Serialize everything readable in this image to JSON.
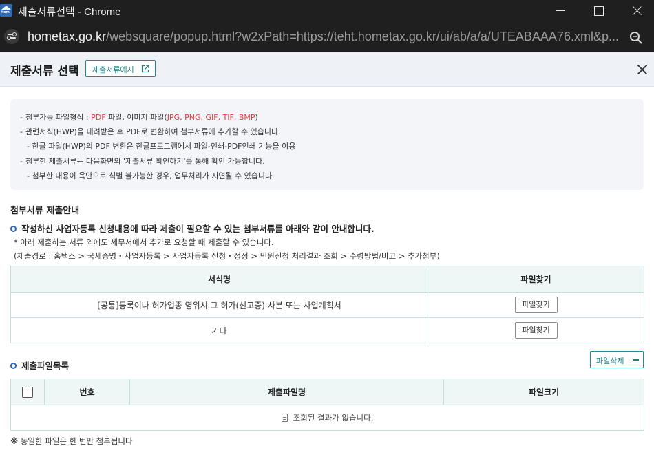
{
  "window": {
    "title": "제출서류선택 - Chrome",
    "app_icon": "hometax-house-icon",
    "app_icon_text": "Hom"
  },
  "address_bar": {
    "host": "hometax.go.kr",
    "path": "/websquare/popup.html?w2xPath=https://teht.hometax.go.kr/ui/ab/a/a/UTEABAAA76.xml&p..."
  },
  "popup": {
    "title": "제출서류 선택",
    "example_button": "제출서류예시"
  },
  "notice": {
    "line1_prefix": "첨부가능 파일형식 : ",
    "line1_pdf": "PDF",
    "line1_mid": " 파일, 이미지 파일(",
    "line1_formats": "JPG, PNG, GIF, TIF, BMP",
    "line1_suffix": ")",
    "line2": "관련서식(HWP)을 내려받은 후 PDF로 변환하여 첨부서류에 추가할 수 있습니다.",
    "line3": "- 한글 파일(HWP)의 PDF 변환은 한글프로그램에서 파일-인쇄-PDF인쇄 기능을 이용",
    "line4": "첨부한 제출서류는 다음화면의 '제출서류 확인하기'를 통해 확인 가능합니다.",
    "line5": "- 첨부한 내용이 육안으로 식별 불가능한 경우, 업무처리가 지연될 수 있습니다."
  },
  "guide": {
    "section_title": "첨부서류 제출안내",
    "headline": "작성하신 사업자등록 신청내용에 따라 제출이 필요할 수 있는 첨부서류를 아래와 같이 안내합니다.",
    "note1": "* 아래 제출하는 서류 외에도 세무서에서 추가로 요청할 때 제출할 수 있습니다.",
    "note2": "(제출경로 : 홈택스 > 국세증명・사업자등록 > 사업자등록 신청・정정 > 민원신청 처리결과 조회 > 수령방법/비고 > 추가첨부)"
  },
  "doc_table": {
    "headers": [
      "서식명",
      "파일찾기"
    ],
    "rows": [
      {
        "name": "[공통]등록이나 허가업종 영위시 그 허가(신고증) 사본 또는 사업계획서",
        "button": "파일찾기"
      },
      {
        "name": "기타",
        "button": "파일찾기"
      }
    ]
  },
  "file_list": {
    "title": "제출파일목록",
    "delete_button": "파일삭제",
    "headers": [
      "번호",
      "제출파일명",
      "파일크기"
    ],
    "empty_message": "조회된 결과가 없습니다."
  },
  "footnote": {
    "mark": "※",
    "text": " 동일한 파일은 한 번만 첨부됩니다"
  }
}
